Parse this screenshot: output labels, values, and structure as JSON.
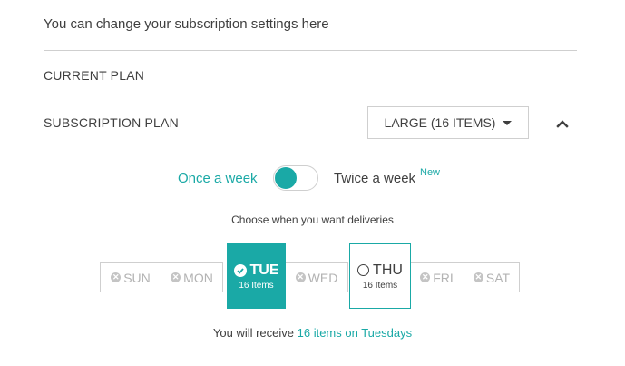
{
  "intro": "You can change your subscription settings here",
  "current_plan_label": "CURRENT PLAN",
  "subscription_plan_label": "SUBSCRIPTION PLAN",
  "plan_select": {
    "selected": "LARGE (16 ITEMS)"
  },
  "frequency": {
    "left": "Once a week",
    "right": "Twice a week",
    "badge": "New",
    "state": "once"
  },
  "choose_text": "Choose when you want deliveries",
  "days": {
    "sun": "SUN",
    "mon": "MON",
    "wed": "WED",
    "fri": "FRI",
    "sat": "SAT",
    "tue": {
      "label": "TUE",
      "sub": "16 Items"
    },
    "thu": {
      "label": "THU",
      "sub": "16 Items"
    }
  },
  "summary": {
    "prefix": "You will receive ",
    "highlight": "16 items on Tuesdays"
  },
  "colors": {
    "accent": "#1aa9a6",
    "border": "#cfcfcf",
    "disabled": "#b3b3b3"
  }
}
